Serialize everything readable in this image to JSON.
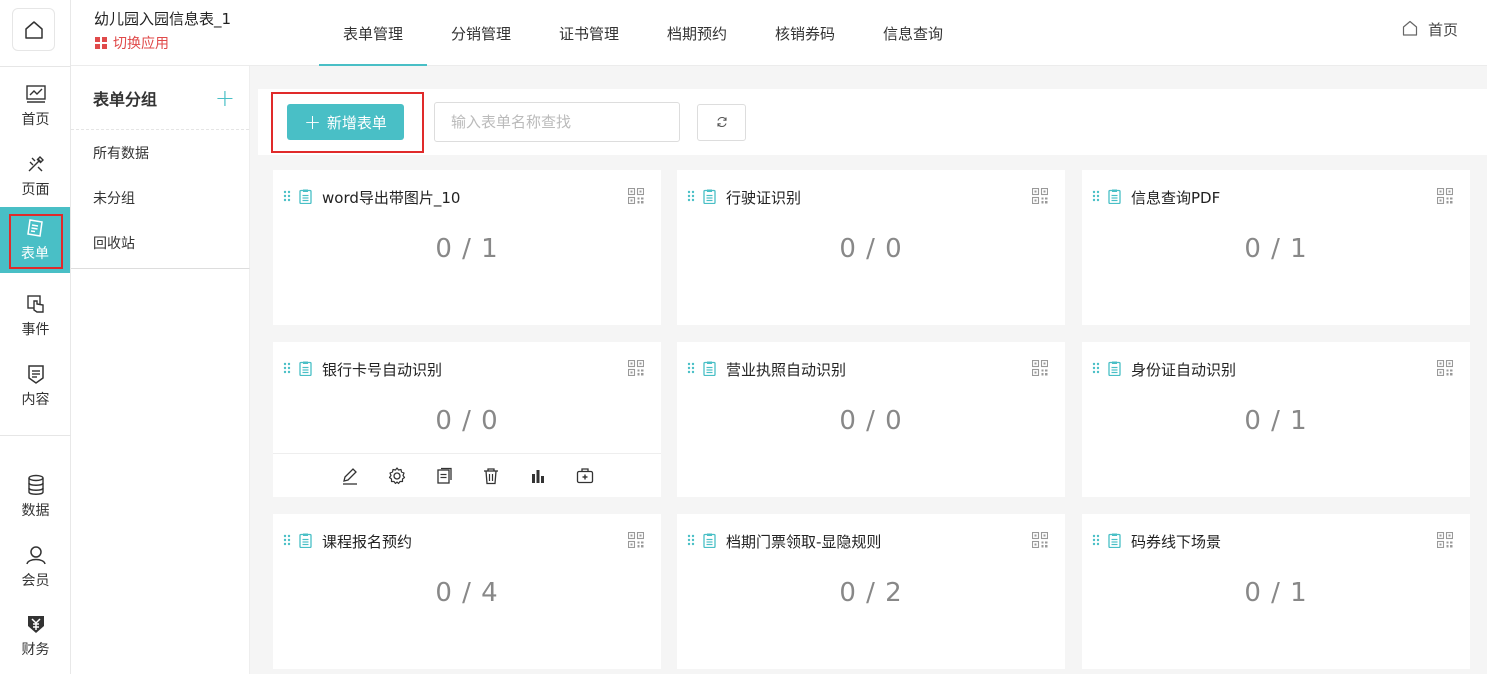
{
  "header": {
    "app_title": "幼儿园入园信息表_1",
    "switch_app": "切换应用",
    "home_label": "首页",
    "tabs": [
      {
        "label": "表单管理",
        "active": true
      },
      {
        "label": "分销管理"
      },
      {
        "label": "证书管理"
      },
      {
        "label": "档期预约"
      },
      {
        "label": "核销券码"
      },
      {
        "label": "信息查询"
      }
    ]
  },
  "rail": {
    "items": [
      {
        "label": "首页",
        "icon": "chart-icon"
      },
      {
        "label": "页面",
        "icon": "brush-icon"
      },
      {
        "label": "表单",
        "icon": "form-icon",
        "active": true
      },
      {
        "label": "事件",
        "icon": "hand-icon"
      },
      {
        "label": "内容",
        "icon": "shield-doc-icon"
      },
      {
        "label": "数据",
        "icon": "database-icon"
      },
      {
        "label": "会员",
        "icon": "user-icon"
      },
      {
        "label": "财务",
        "icon": "yen-icon"
      }
    ]
  },
  "groups": {
    "title": "表单分组",
    "items": [
      "所有数据",
      "未分组",
      "回收站"
    ]
  },
  "toolbar": {
    "add_label": "新增表单",
    "search_placeholder": "输入表单名称查找"
  },
  "accent_color": "#49bfc6",
  "highlight_color": "#e02a2a",
  "cards": [
    {
      "name": "word导出带图片_10",
      "ratio": "0 / 1"
    },
    {
      "name": "行驶证识别",
      "ratio": "0 / 0"
    },
    {
      "name": "信息查询PDF",
      "ratio": "0 / 1"
    },
    {
      "name": "银行卡号自动识别",
      "ratio": "0 / 0"
    },
    {
      "name": "营业执照自动识别",
      "ratio": "0 / 0"
    },
    {
      "name": "身份证自动识别",
      "ratio": "0 / 1"
    },
    {
      "name": "课程报名预约",
      "ratio": "0 / 4"
    },
    {
      "name": "档期门票领取-显隐规则",
      "ratio": "0 / 2"
    },
    {
      "name": "码券线下场景",
      "ratio": "0 / 1"
    }
  ]
}
